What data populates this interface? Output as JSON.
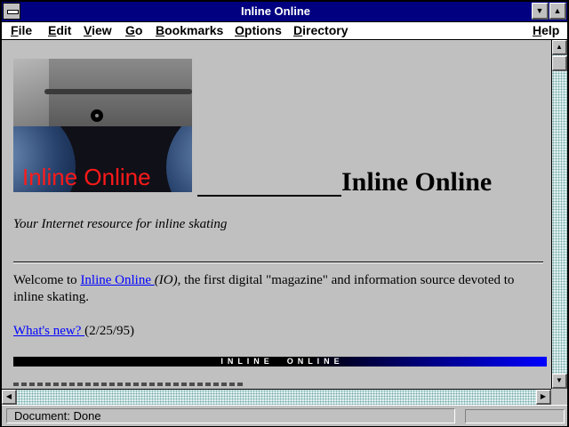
{
  "window": {
    "title": "Inline Online"
  },
  "menu": [
    "File",
    "Edit",
    "View",
    "Go",
    "Bookmarks",
    "Options",
    "Directory",
    "Help"
  ],
  "page": {
    "logo_text": "Inline Online",
    "heading": "Inline Online",
    "tagline": "Your Internet resource for inline skating",
    "welcome_prefix": "Welcome to ",
    "welcome_link": "Inline Online ",
    "welcome_abbrev": "(IO)",
    "welcome_suffix": ", the first digital \"magazine\" and information source devoted to inline skating.",
    "whats_new_link": "What's new? ",
    "whats_new_date": "(2/25/95)",
    "banner_text": "I  N  L  I  N  E        O  N  L  I  N  E"
  },
  "status": {
    "text": "Document: Done",
    "progress": 0
  },
  "colors": {
    "title_bar": "#000080",
    "link": "#0000ff",
    "logo_text": "#ff1a1a",
    "background": "#c0c0c0"
  }
}
